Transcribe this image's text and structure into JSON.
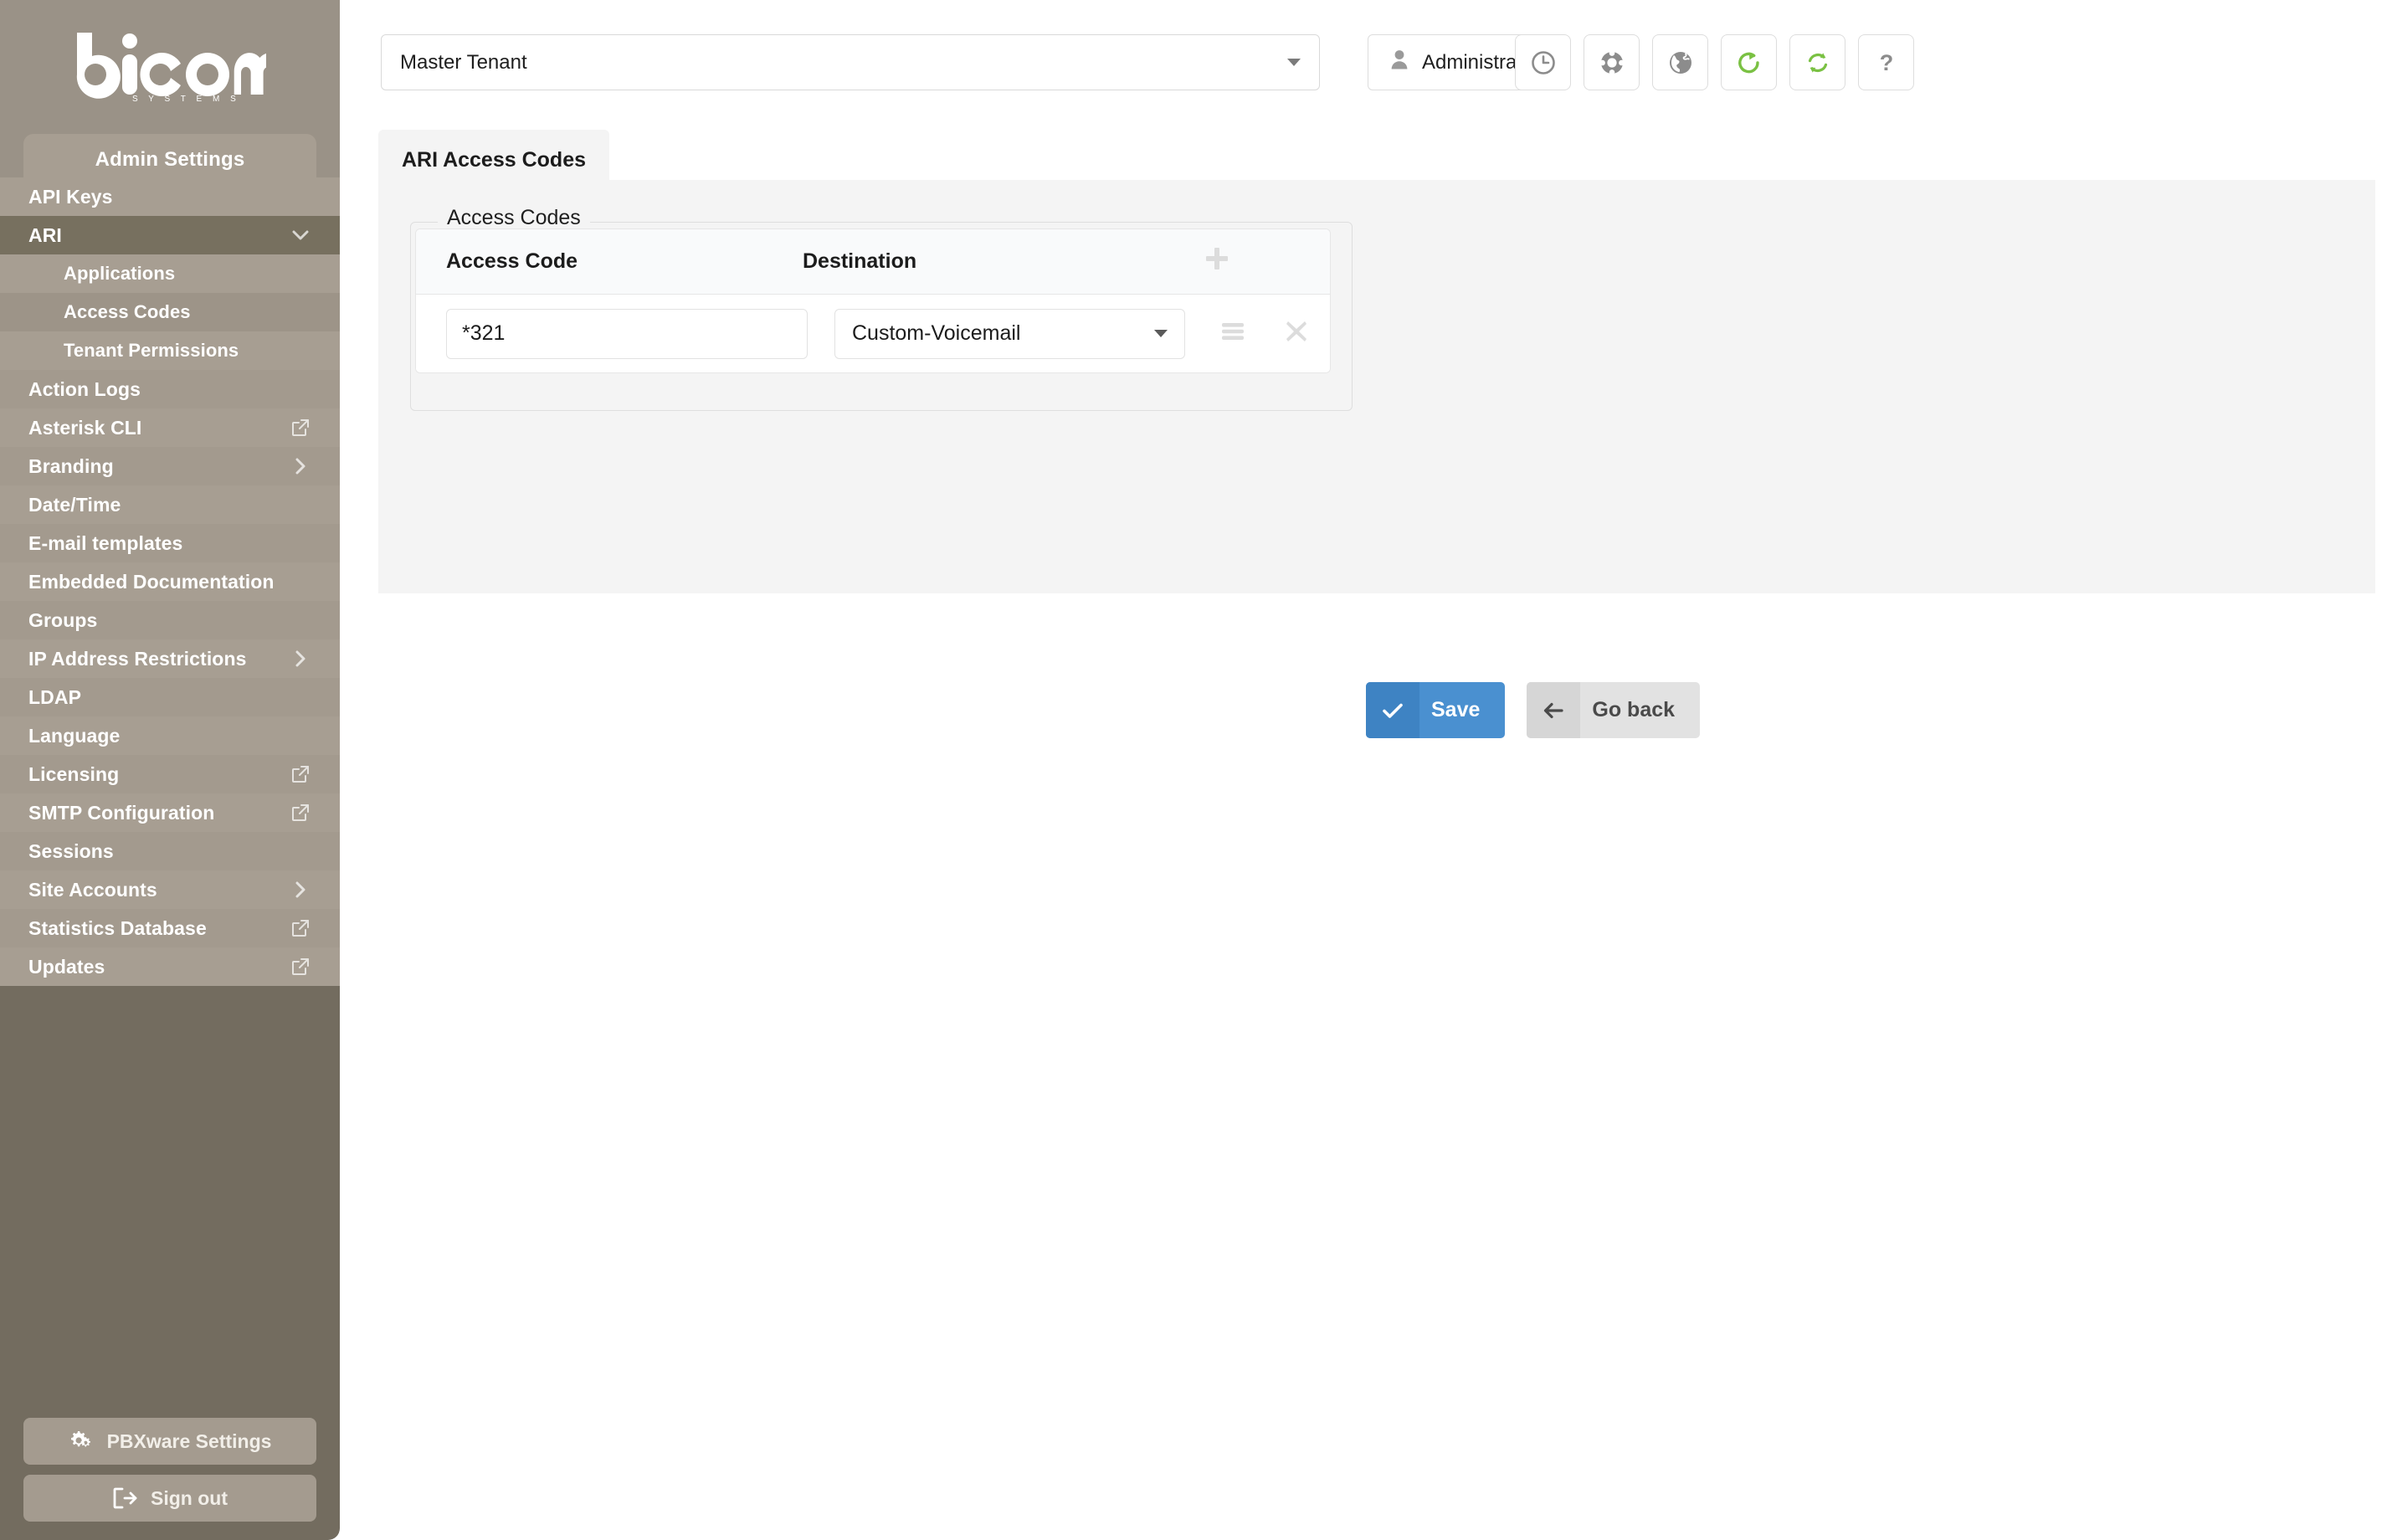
{
  "brand": {
    "logo_text": "bicom",
    "logo_subtext": "S Y S T E M S"
  },
  "sidebar": {
    "tab_label": "Admin Settings",
    "items": [
      {
        "label": "API Keys",
        "level": 1,
        "trail": "none"
      },
      {
        "label": "ARI",
        "level": 1,
        "trail": "chevron-down-icon",
        "active": true
      },
      {
        "label": "Applications",
        "level": 2,
        "trail": "none"
      },
      {
        "label": "Access Codes",
        "level": 2,
        "trail": "none",
        "selected": true
      },
      {
        "label": "Tenant Permissions",
        "level": 2,
        "trail": "none"
      },
      {
        "label": "Action Logs",
        "level": 1,
        "trail": "none"
      },
      {
        "label": "Asterisk CLI",
        "level": 1,
        "trail": "external-link-icon"
      },
      {
        "label": "Branding",
        "level": 1,
        "trail": "chevron-right-icon"
      },
      {
        "label": "Date/Time",
        "level": 1,
        "trail": "none"
      },
      {
        "label": "E-mail templates",
        "level": 1,
        "trail": "none"
      },
      {
        "label": "Embedded Documentation",
        "level": 1,
        "trail": "none"
      },
      {
        "label": "Groups",
        "level": 1,
        "trail": "none"
      },
      {
        "label": "IP Address Restrictions",
        "level": 1,
        "trail": "chevron-right-icon"
      },
      {
        "label": "LDAP",
        "level": 1,
        "trail": "none"
      },
      {
        "label": "Language",
        "level": 1,
        "trail": "none"
      },
      {
        "label": "Licensing",
        "level": 1,
        "trail": "external-link-icon"
      },
      {
        "label": "SMTP Configuration",
        "level": 1,
        "trail": "external-link-icon"
      },
      {
        "label": "Sessions",
        "level": 1,
        "trail": "none"
      },
      {
        "label": "Site Accounts",
        "level": 1,
        "trail": "chevron-right-icon"
      },
      {
        "label": "Statistics Database",
        "level": 1,
        "trail": "external-link-icon"
      },
      {
        "label": "Updates",
        "level": 1,
        "trail": "external-link-icon"
      }
    ],
    "footer": {
      "settings_label": "PBXware Settings",
      "settings_icon": "gears-icon",
      "signout_label": "Sign out",
      "signout_icon": "sign-out-icon"
    }
  },
  "topbar": {
    "tenant_value": "Master Tenant",
    "user_label": "Administrator",
    "user_icon": "user-icon",
    "icon_buttons": [
      {
        "name": "clock-icon",
        "title": "Clock"
      },
      {
        "name": "lifebuoy-icon",
        "title": "Support"
      },
      {
        "name": "globe-icon",
        "title": "Globe"
      },
      {
        "name": "reload-icon",
        "title": "Reload"
      },
      {
        "name": "sync-icon",
        "title": "Sync"
      },
      {
        "name": "help-icon",
        "title": "Help"
      }
    ]
  },
  "main": {
    "tab_label": "ARI Access Codes",
    "fieldset_legend": "Access Codes",
    "table": {
      "columns": [
        "Access Code",
        "Destination"
      ],
      "add_icon": "plus-icon",
      "rows": [
        {
          "access_code": "*321",
          "access_code_placeholder": "",
          "destination": "Custom-Voicemail",
          "drag_icon": "drag-handle-icon",
          "delete_icon": "close-icon"
        }
      ]
    },
    "buttons": {
      "save_label": "Save",
      "save_icon": "check-icon",
      "goback_label": "Go back",
      "goback_icon": "arrow-left-icon"
    }
  },
  "colors": {
    "sidebar_dark": "#736c5f",
    "sidebar_mid": "#9a9287",
    "sidebar_light": "#a79e92",
    "nav_active": "#77705f",
    "accent_blue": "#4a90d0",
    "accent_green": "#7ac143",
    "panel_bg": "#f4f4f4"
  }
}
